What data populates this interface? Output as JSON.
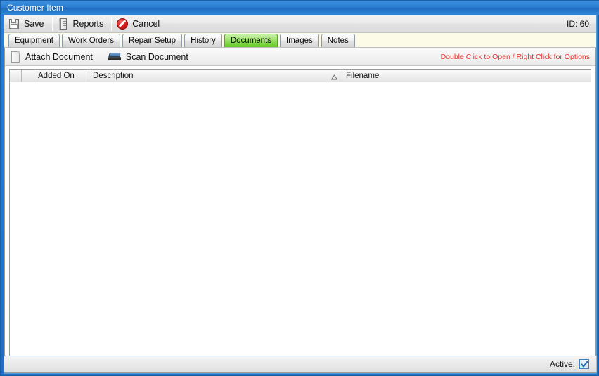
{
  "window": {
    "title": "Customer Item"
  },
  "toolbar": {
    "save_label": "Save",
    "reports_label": "Reports",
    "cancel_label": "Cancel",
    "id_text": "ID: 60",
    "icons": {
      "save": "save-floppy-icon",
      "reports": "report-document-icon",
      "cancel": "cancel-circle-slash-icon"
    }
  },
  "tabs": [
    {
      "label": "Equipment",
      "active": false
    },
    {
      "label": "Work Orders",
      "active": false
    },
    {
      "label": "Repair Setup",
      "active": false
    },
    {
      "label": "History",
      "active": false
    },
    {
      "label": "Documents",
      "active": true
    },
    {
      "label": "Images",
      "active": false
    },
    {
      "label": "Notes",
      "active": false
    }
  ],
  "actionbar": {
    "attach_label": "Attach Document",
    "scan_label": "Scan Document",
    "hint": "Double Click to Open / Right Click for Options",
    "hint_color": "#e8312a",
    "icons": {
      "attach": "document-page-icon",
      "scan": "scanner-icon"
    }
  },
  "grid": {
    "columns": [
      {
        "key": "rownum",
        "label": ""
      },
      {
        "key": "select",
        "label": ""
      },
      {
        "key": "added_on",
        "label": "Added On"
      },
      {
        "key": "description",
        "label": "Description",
        "sorted": "ascending",
        "sort_icon": "sort-ascending-triangle-icon"
      },
      {
        "key": "filename",
        "label": "Filename"
      }
    ],
    "rows": []
  },
  "statusbar": {
    "active_label": "Active:",
    "active_checked": true,
    "checkbox_icon": "checkmark-icon"
  },
  "colors": {
    "title_bar": "#2a7ed2",
    "active_tab": "#7ed545",
    "tabstrip_bg": "#fbfbe8",
    "hint_red": "#e8312a",
    "frame_blue": "#1f6fc4"
  }
}
